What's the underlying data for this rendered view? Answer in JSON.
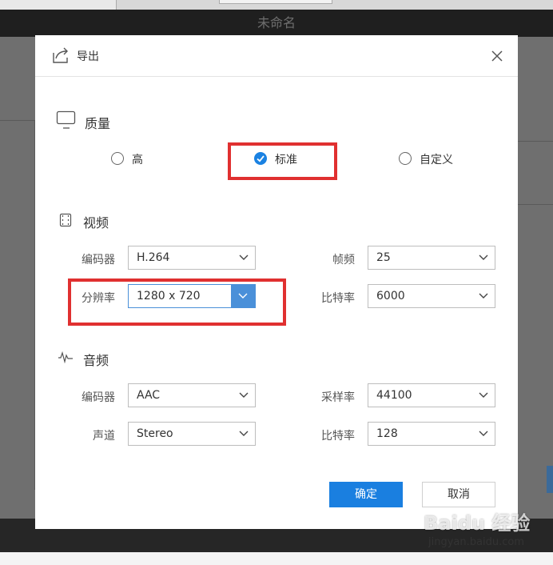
{
  "app": {
    "window_title": "未命名"
  },
  "dialog": {
    "title": "导出",
    "quality": {
      "section_title": "质量",
      "options": [
        {
          "label": "高",
          "selected": false
        },
        {
          "label": "标准",
          "selected": true
        },
        {
          "label": "自定义",
          "selected": false
        }
      ]
    },
    "video": {
      "section_title": "视频",
      "encoder_label": "编码器",
      "encoder_value": "H.264",
      "fps_label": "帧频",
      "fps_value": "25",
      "resolution_label": "分辨率",
      "resolution_value": "1280 x 720",
      "bitrate_label": "比特率",
      "bitrate_value": "6000"
    },
    "audio": {
      "section_title": "音频",
      "encoder_label": "编码器",
      "encoder_value": "AAC",
      "samplerate_label": "采样率",
      "samplerate_value": "44100",
      "channel_label": "声道",
      "channel_value": "Stereo",
      "bitrate_label": "比特率",
      "bitrate_value": "128"
    },
    "buttons": {
      "confirm": "确定",
      "cancel": "取消"
    }
  },
  "watermark": {
    "brand": "Baidu 经验",
    "url": "jingyan.baidu.com"
  },
  "colors": {
    "accent": "#1a7fe0",
    "highlight_box": "#e03030",
    "dropdown_active": "#4a90d9"
  }
}
